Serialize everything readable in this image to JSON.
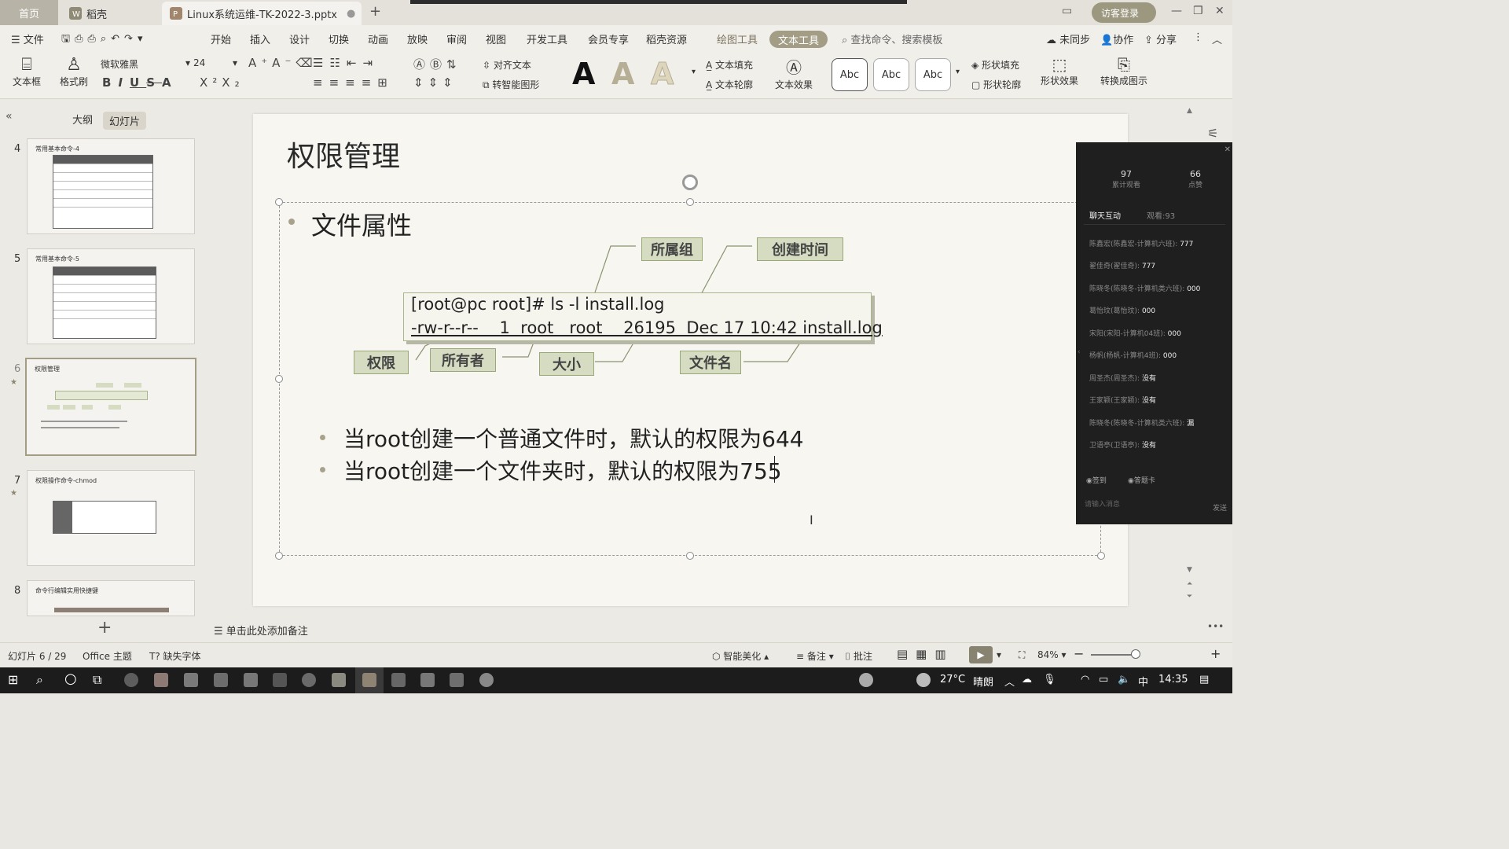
{
  "titlebar": {
    "home_tab": "首页",
    "tabs": [
      {
        "label": "稻壳",
        "icon": "wps-docer-icon"
      },
      {
        "label": "Linux系统运维-TK-2022-3.pptx",
        "icon": "ppt-file-icon"
      }
    ],
    "login_label": "访客登录"
  },
  "menubar": {
    "file_label": "文件",
    "items": [
      "开始",
      "插入",
      "设计",
      "切换",
      "动画",
      "放映",
      "审阅",
      "视图",
      "开发工具",
      "会员专享",
      "稻壳资源"
    ],
    "drawing_tools": "绘图工具",
    "text_tools": "文本工具",
    "search_placeholder": "查找命令、搜索模板",
    "right": {
      "sync": "未同步",
      "collab": "协作",
      "share": "分享"
    }
  },
  "ribbon": {
    "textbox": "文本框",
    "format_painter": "格式刷",
    "font_name": "微软雅黑",
    "font_size": "24",
    "align_text": "对齐文本",
    "smart_shape": "转智能图形",
    "text_fill": "文本填充",
    "text_outline": "文本轮廓",
    "text_effect": "文本效果",
    "abc_styles": [
      "Abc",
      "Abc",
      "Abc"
    ],
    "shape_fill": "形状填充",
    "shape_outline": "形状轮廓",
    "shape_effect": "形状效果",
    "convert_graphic": "转换成图示"
  },
  "leftpanel": {
    "tab_outline": "大纲",
    "tab_slides": "幻灯片",
    "thumbs": [
      {
        "num": "4",
        "title": "常用基本命令-4"
      },
      {
        "num": "5",
        "title": "常用基本命令-5"
      },
      {
        "num": "6",
        "title": "权限管理"
      },
      {
        "num": "7",
        "title": "权限操作命令-chmod"
      },
      {
        "num": "8",
        "title": "命令行编辑实用快捷键"
      }
    ]
  },
  "slide": {
    "title": "权限管理",
    "bullet": "文件属性",
    "cmd_line1": "[root@pc root]# ls -l install.log",
    "cmd_line2": "-rw-r--r--    1  root   root    26195  Dec 17 10:42 install.log",
    "labels": {
      "group": "所属组",
      "ctime": "创建时间",
      "perm": "权限",
      "owner": "所有者",
      "size": "大小",
      "filename": "文件名"
    },
    "sub_bullets": [
      "当root创建一个普通文件时，默认的权限为644",
      "当root创建一个文件夹时，默认的权限为755"
    ],
    "notes_placeholder": "单击此处添加备注"
  },
  "chat": {
    "stats": [
      {
        "value": "97",
        "label": "累计观看"
      },
      {
        "value": "66",
        "label": "点赞"
      }
    ],
    "tabs": [
      "聊天互动",
      "观看:93"
    ],
    "messages": [
      {
        "name": "陈鑫宏(陈鑫宏-计算机六班):",
        "text": "777"
      },
      {
        "name": "翟佳奇(翟佳奇):",
        "text": "777"
      },
      {
        "name": "陈晓冬(陈晓冬-计算机类六班):",
        "text": "000"
      },
      {
        "name": "葛怡玟(葛怡玟):",
        "text": "000"
      },
      {
        "name": "宋阳(宋阳-计算机04班):",
        "text": "000"
      },
      {
        "name": "杨帆(杨帆-计算机4班):",
        "text": "000"
      },
      {
        "name": "周圣杰(周圣杰):",
        "text": "没有"
      },
      {
        "name": "王家颖(王家颖):",
        "text": "没有"
      },
      {
        "name": "陈晓冬(陈晓冬-计算机类六班):",
        "text": "漏"
      },
      {
        "name": "卫语亭(卫语亭):",
        "text": "没有"
      }
    ],
    "signin": "签到",
    "answer_card": "答题卡",
    "input_placeholder": "请输入消息",
    "send": "发送"
  },
  "statusbar": {
    "slide_info": "幻灯片 6 / 29",
    "theme": "Office 主题",
    "missing_font": "缺失字体",
    "beautify": "智能美化",
    "notes": "备注",
    "comment": "批注",
    "zoom": "84%"
  },
  "taskbar": {
    "weather_temp": "27°C",
    "weather_desc": "晴朗",
    "ime": "中",
    "time": "14:35"
  }
}
